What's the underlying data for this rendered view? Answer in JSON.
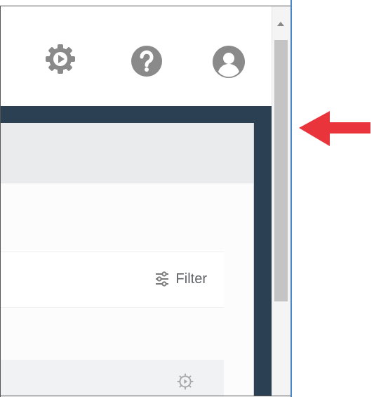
{
  "header": {
    "icons": [
      "settings-play-icon",
      "help-icon",
      "account-icon"
    ]
  },
  "toolbar": {
    "filter_label": "Filter",
    "filter_icon": "sliders-icon"
  },
  "list": {
    "row_action_icon": "settings-play-icon"
  },
  "annotation": {
    "arrow_color": "#e8343a",
    "arrow_direction": "left"
  },
  "colors": {
    "dark_band": "#2c4054",
    "window_border": "#4a86c8",
    "icon_gray": "#8a8a8a"
  }
}
